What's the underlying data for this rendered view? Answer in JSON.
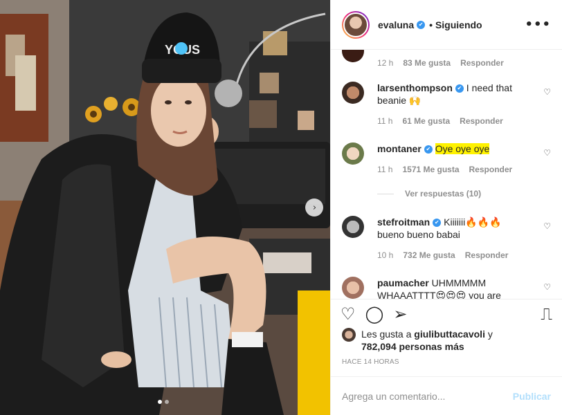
{
  "header": {
    "username": "evaluna",
    "verified_badge": "✔",
    "separator": "•",
    "follow_status": "Siguiendo",
    "more_icon": "•••"
  },
  "photo": {
    "next_arrow": "›",
    "beanie_text": "YOUS",
    "carousel_total": 2,
    "carousel_current": 1
  },
  "comments": [
    {
      "user": "",
      "text": "",
      "time": "12 h",
      "likes": "83 Me gusta",
      "reply": "Responder"
    },
    {
      "user": "larsenthompson",
      "verified": true,
      "text": "I need that beanie 🙌",
      "time": "11 h",
      "likes": "61 Me gusta",
      "reply": "Responder"
    },
    {
      "user": "montaner",
      "verified": true,
      "text": "Oye oye oye",
      "time": "11 h",
      "likes": "1571 Me gusta",
      "reply": "Responder",
      "view_replies": "Ver respuestas (10)"
    },
    {
      "user": "stefroitman",
      "verified": true,
      "text": "Kiiiiiii🔥🔥🔥 bueno bueno babai",
      "time": "10 h",
      "likes": "732 Me gusta",
      "reply": "Responder"
    },
    {
      "user": "paumacher",
      "verified": false,
      "text": "UHMMMMM WHAAATTTT😍😍😍 you are",
      "time": "",
      "likes": "",
      "reply": ""
    }
  ],
  "actions": {
    "like_icon": "♡",
    "comment_icon": "◯",
    "share_icon": "➢",
    "save_icon": "⎍"
  },
  "likes_summary": {
    "prefix": "Les gusta a",
    "first_user": "giulibuttacavoli",
    "joiner": "y",
    "others": "782,094 personas más"
  },
  "timestamp": "HACE 14 HORAS",
  "add_comment": {
    "placeholder": "Agrega un comentario...",
    "publish_label": "Publicar"
  },
  "colors": {
    "accent": "#3897f0",
    "highlight": "#fff200",
    "publish_disabled": "#b2dffc"
  }
}
